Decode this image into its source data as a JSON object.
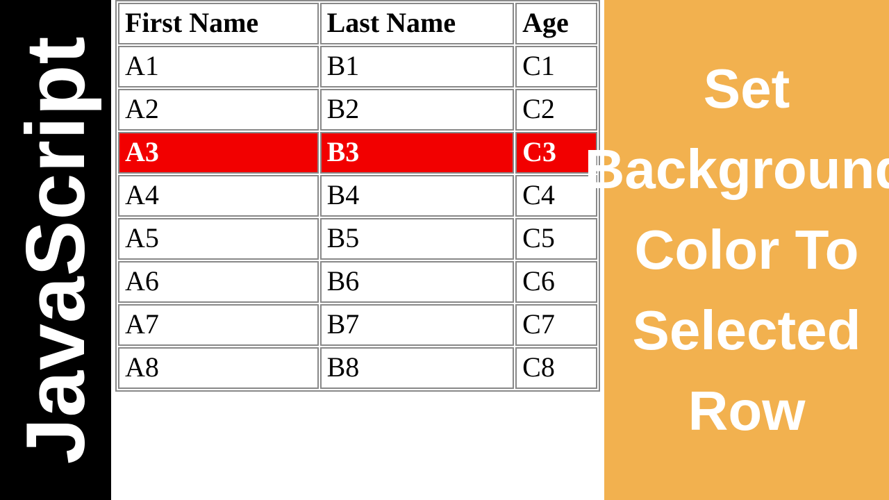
{
  "left": {
    "label": "JavaScript"
  },
  "right": {
    "title": "Set Background Color To Selected Row"
  },
  "table": {
    "headers": [
      "First Name",
      "Last Name",
      "Age"
    ],
    "rows": [
      {
        "cells": [
          "A1",
          "B1",
          "C1"
        ],
        "selected": false
      },
      {
        "cells": [
          "A2",
          "B2",
          "C2"
        ],
        "selected": false
      },
      {
        "cells": [
          "A3",
          "B3",
          "C3"
        ],
        "selected": true
      },
      {
        "cells": [
          "A4",
          "B4",
          "C4"
        ],
        "selected": false
      },
      {
        "cells": [
          "A5",
          "B5",
          "C5"
        ],
        "selected": false
      },
      {
        "cells": [
          "A6",
          "B6",
          "C6"
        ],
        "selected": false
      },
      {
        "cells": [
          "A7",
          "B7",
          "C7"
        ],
        "selected": false
      },
      {
        "cells": [
          "A8",
          "B8",
          "C8"
        ],
        "selected": false
      }
    ]
  },
  "colors": {
    "selected_bg": "#f20000",
    "right_bg": "#f2b14f"
  }
}
